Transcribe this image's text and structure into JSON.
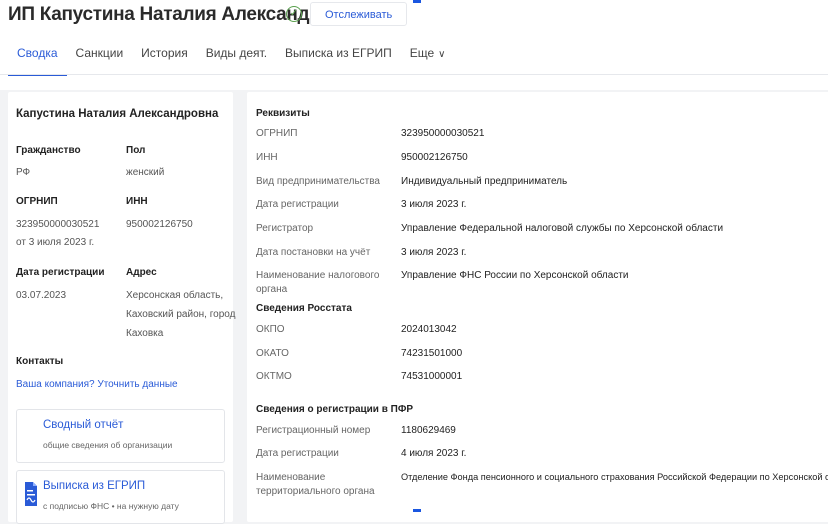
{
  "header": {
    "title": "ИП Капустина Наталия Александровна",
    "verified_icon": "check-circle-icon",
    "follow_label": "Отслеживать",
    "accent_color": "#2a5bd7"
  },
  "tabs": [
    {
      "label": "Сводка",
      "active": true
    },
    {
      "label": "Санкции"
    },
    {
      "label": "История"
    },
    {
      "label": "Виды деят."
    },
    {
      "label": "Выписка из ЕГРИП"
    },
    {
      "label": "Еще"
    }
  ],
  "summary": {
    "name": "Капустина Наталия Александровна",
    "citizenship_label": "Гражданство",
    "citizenship_value": "РФ",
    "gender_label": "Пол",
    "gender_value": "женский",
    "ogrnip_label": "ОГРНИП",
    "ogrnip_value": "323950000030521",
    "ogrnip_date": "от 3 июля 2023 г.",
    "inn_label": "ИНН",
    "inn_value": "950002126750",
    "reg_date_label": "Дата регистрации",
    "reg_date_value": "03.07.2023",
    "address_label": "Адрес",
    "address_lines": [
      "Херсонская область,",
      "Каховский район, город",
      "Каховка"
    ],
    "contacts_label": "Контакты",
    "contacts_link": "Ваша компания? Уточнить данные",
    "report_title": "Сводный отчёт",
    "report_sub": "общие сведения об организации",
    "egrip_title": "Выписка из ЕГРИП",
    "egrip_sub": "с подписью ФНС • на нужную дату"
  },
  "details": {
    "requisites": {
      "title": "Реквизиты",
      "rows": [
        {
          "k": "ОГРНИП",
          "v": "323950000030521"
        },
        {
          "k": "ИНН",
          "v": "950002126750"
        },
        {
          "k": "Вид предпринимательства",
          "v": "Индивидуальный предприниматель"
        },
        {
          "k": "Дата регистрации",
          "v": "3 июля 2023 г."
        },
        {
          "k": "Регистратор",
          "v": "Управление Федеральной налоговой службы по Херсонской области"
        },
        {
          "k": "Дата постановки на учёт",
          "v": "3 июля 2023 г."
        },
        {
          "k": "Наименование налогового органа",
          "v": "Управление ФНС России по Херсонской области"
        }
      ]
    },
    "rosstat": {
      "title": "Сведения Росстата",
      "rows": [
        {
          "k": "ОКПО",
          "v": "2024013042"
        },
        {
          "k": "ОКАТО",
          "v": "74231501000"
        },
        {
          "k": "ОКТМО",
          "v": "74531000001"
        }
      ]
    },
    "pfr": {
      "title": "Сведения о регистрации в ПФР",
      "rows": [
        {
          "k": "Регистрационный номер",
          "v": "1180629469"
        },
        {
          "k": "Дата регистрации",
          "v": "4 июля 2023 г."
        },
        {
          "k": "Наименование территориального органа",
          "v": "Отделение Фонда пенсионного и социального страхования Российской Федерации по Херсонской области"
        }
      ]
    }
  }
}
